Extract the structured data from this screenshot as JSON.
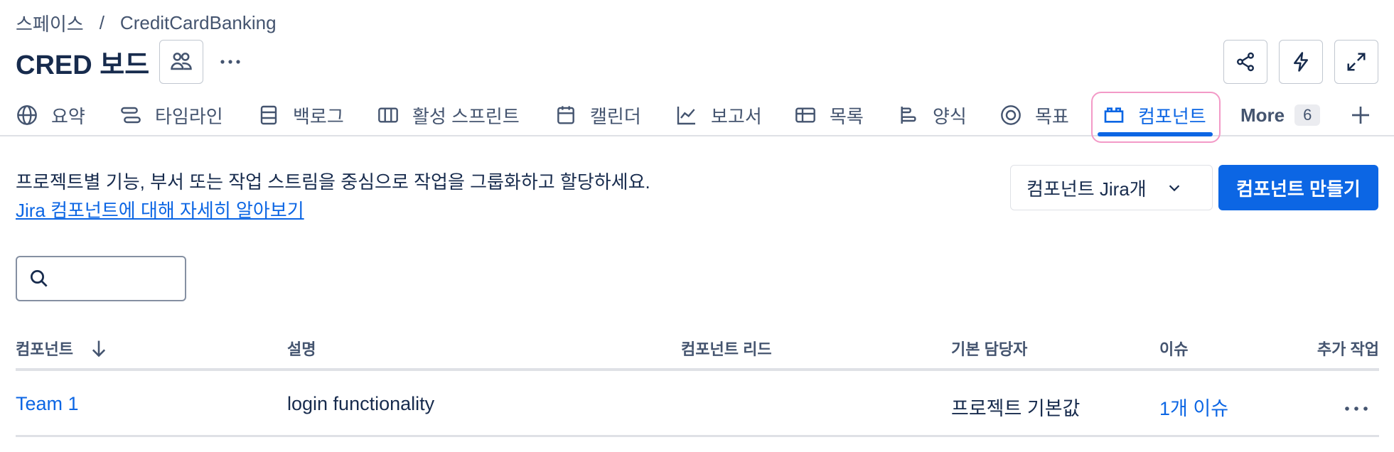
{
  "breadcrumb": {
    "space": "스페이스",
    "separator": "/",
    "project": "CreditCardBanking"
  },
  "page": {
    "title": "CRED 보드",
    "more_dots": "···"
  },
  "header_actions": [
    "share-icon",
    "automation-icon",
    "fullscreen-icon"
  ],
  "tabs": [
    {
      "label": "요약",
      "icon": "globe-icon"
    },
    {
      "label": "타임라인",
      "icon": "timeline-icon"
    },
    {
      "label": "백로그",
      "icon": "backlog-icon"
    },
    {
      "label": "활성 스프린트",
      "icon": "board-icon"
    },
    {
      "label": "캘린더",
      "icon": "calendar-icon"
    },
    {
      "label": "보고서",
      "icon": "chart-line-icon"
    },
    {
      "label": "목록",
      "icon": "list-icon"
    },
    {
      "label": "양식",
      "icon": "form-icon"
    },
    {
      "label": "목표",
      "icon": "target-icon"
    },
    {
      "label": "컴포넌트",
      "icon": "component-icon",
      "active": true
    }
  ],
  "more_tab": {
    "label": "More",
    "count": "6"
  },
  "intro": {
    "text": "프로젝트별 기능, 부서 또는 작업 스트림을 중심으로 작업을 그룹화하고 할당하세요.",
    "link": "Jira 컴포넌트에 대해 자세히 알아보기"
  },
  "filter_dropdown": {
    "label": "컴포넌트 Jira개"
  },
  "create_button": {
    "label": "컴포넌트 만들기"
  },
  "search": {
    "placeholder": ""
  },
  "table": {
    "headers": [
      "컴포넌트",
      "설명",
      "컴포넌트 리드",
      "기본 담당자",
      "이슈",
      "추가 작업"
    ],
    "rows": [
      {
        "component": "Team 1",
        "description": "login functionality",
        "lead": "",
        "assignee": "프로젝트 기본값",
        "issues": "1개 이슈",
        "actions": "···"
      }
    ]
  },
  "colors": {
    "accent": "#0c66e4",
    "highlight_outline": "#f39ac7",
    "text": "#172b4d",
    "subtle": "#44546f"
  }
}
